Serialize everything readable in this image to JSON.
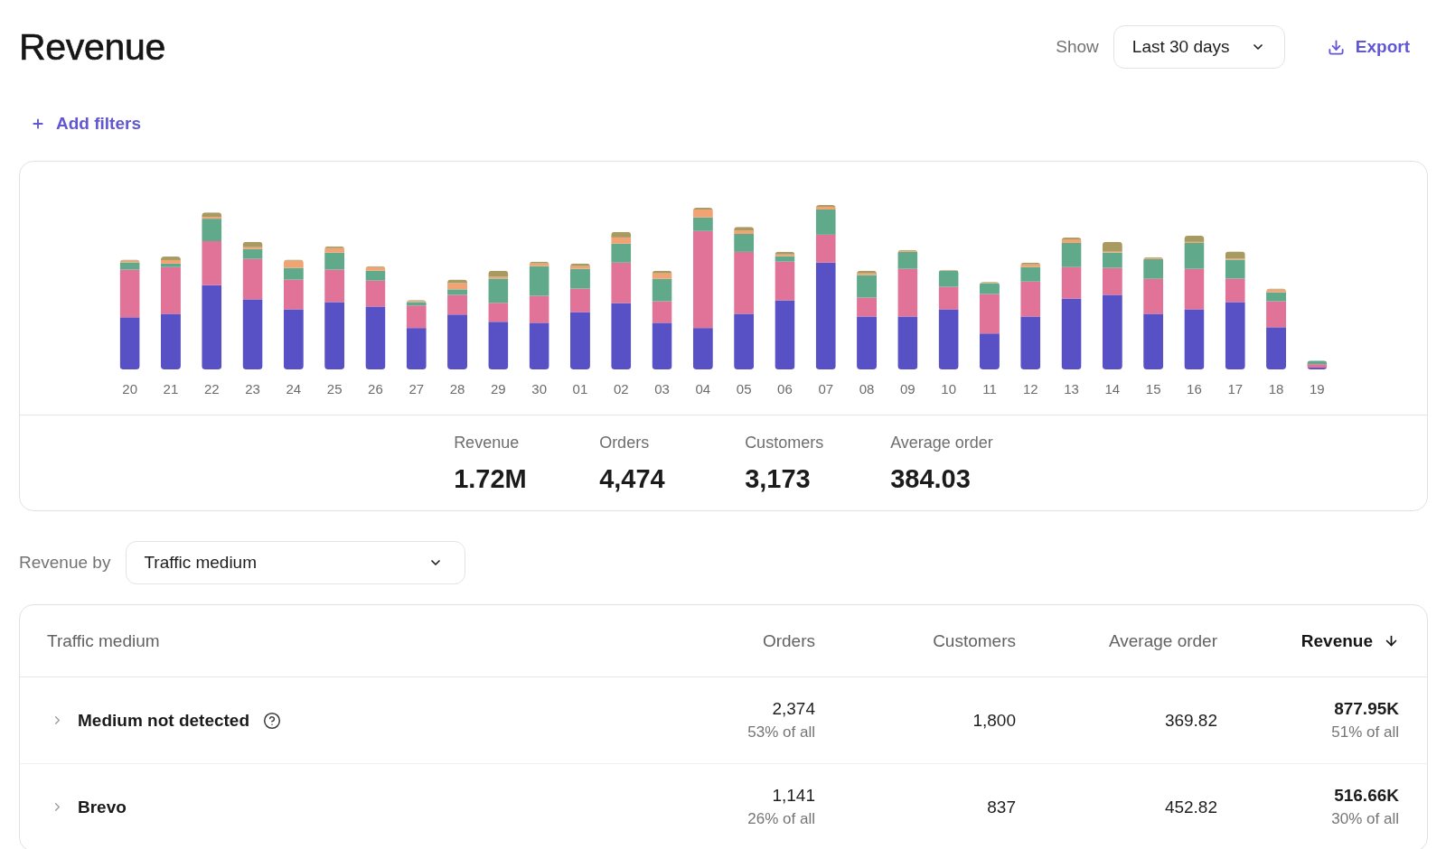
{
  "header": {
    "title": "Revenue",
    "range": {
      "label": "Show",
      "value": "Last 30 days"
    },
    "export_button": "Export"
  },
  "filters": {
    "add_button": "Add filters"
  },
  "chart_card": {
    "day_labels": [
      "20",
      "21",
      "22",
      "23",
      "24",
      "25",
      "26",
      "27",
      "28",
      "29",
      "30",
      "01",
      "02",
      "03",
      "04",
      "05",
      "06",
      "07",
      "08",
      "09",
      "10",
      "11",
      "12",
      "13",
      "14",
      "15",
      "16",
      "17",
      "18",
      "19"
    ],
    "stats": [
      {
        "label": "Revenue",
        "value": "1.72M"
      },
      {
        "label": "Orders",
        "value": "4,474"
      },
      {
        "label": "Customers",
        "value": "3,173"
      },
      {
        "label": "Average order",
        "value": "384.03"
      }
    ]
  },
  "breakdown": {
    "label": "Revenue by",
    "value": "Traffic medium"
  },
  "table": {
    "columns": [
      {
        "label": "Traffic medium",
        "sorted": false
      },
      {
        "label": "Orders",
        "sorted": false
      },
      {
        "label": "Customers",
        "sorted": false
      },
      {
        "label": "Average order",
        "sorted": false
      },
      {
        "label": "Revenue",
        "sorted": true,
        "descending": true
      }
    ],
    "rows": [
      {
        "name": "Medium not detected",
        "help": true,
        "expanded": false,
        "orders": "2,374",
        "orders_share": "53% of all",
        "customers": "1,800",
        "average_order": "369.82",
        "revenue": "877.95K",
        "revenue_share": "51% of all"
      },
      {
        "name": "Brevo",
        "help": false,
        "expanded": false,
        "orders": "1,141",
        "orders_share": "26% of all",
        "customers": "837",
        "average_order": "452.82",
        "revenue": "516.66K",
        "revenue_share": "30% of all"
      }
    ]
  }
}
